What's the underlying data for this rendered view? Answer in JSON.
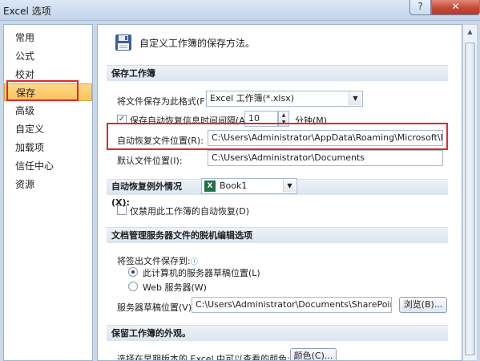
{
  "window": {
    "title": "Excel 选项",
    "help_label": "?",
    "close_label": "✕"
  },
  "sidebar": {
    "items": [
      {
        "label": "常用"
      },
      {
        "label": "公式"
      },
      {
        "label": "校对"
      },
      {
        "label": "保存",
        "active": true
      },
      {
        "label": "高级"
      },
      {
        "label": "自定义"
      },
      {
        "label": "加载项"
      },
      {
        "label": "信任中心"
      },
      {
        "label": "资源"
      }
    ]
  },
  "header": {
    "icon": "floppy-disk-icon",
    "text": "自定义工作簿的保存方法。"
  },
  "save_section": {
    "title": "保存工作簿",
    "format_label": "将文件保存为此格式(F):",
    "format_value": "Excel 工作簿(*.xlsx)",
    "autorecover_label": "保存自动恢复信息时间间隔(A)",
    "autorecover_checked": true,
    "autorecover_minutes": "10",
    "minutes_unit": "分钟(M)",
    "autorecover_location_label": "自动恢复文件位置(R):",
    "autorecover_location_value": "C:\\Users\\Administrator\\AppData\\Roaming\\Microsoft\\Excel\\",
    "default_location_label": "默认文件位置(I):",
    "default_location_value": "C:\\Users\\Administrator\\Documents"
  },
  "exceptions_section": {
    "title": "自动恢复例外情况(X):",
    "workbook_value": "Book1",
    "workbook_icon": "excel-file-icon",
    "disable_label": "仅禁用此工作簿的自动恢复(D)",
    "disable_checked": false
  },
  "offline_section": {
    "title": "文档管理服务器文件的脱机编辑选项",
    "save_to_label": "将签出文件保存到:",
    "option_server_drafts": "此计算机的服务器草稿位置(L)",
    "option_web_server": "Web 服务器(W)",
    "selected_option": "此计算机的服务器草稿位置(L)",
    "drafts_location_label": "服务器草稿位置(V):",
    "drafts_location_value": "C:\\Users\\Administrator\\Documents\\SharePoint 草稿\\",
    "browse_label": "浏览(B)..."
  },
  "appearance_section": {
    "title": "保留工作簿的外观。",
    "colors_label": "选择在早期版本的 Excel 中可以查看的颜色:",
    "colors_button": "颜色(C)..."
  },
  "colors": {
    "highlight": "#e0282c",
    "active_nav": "#f9c25a",
    "link": "#1a56b8"
  }
}
